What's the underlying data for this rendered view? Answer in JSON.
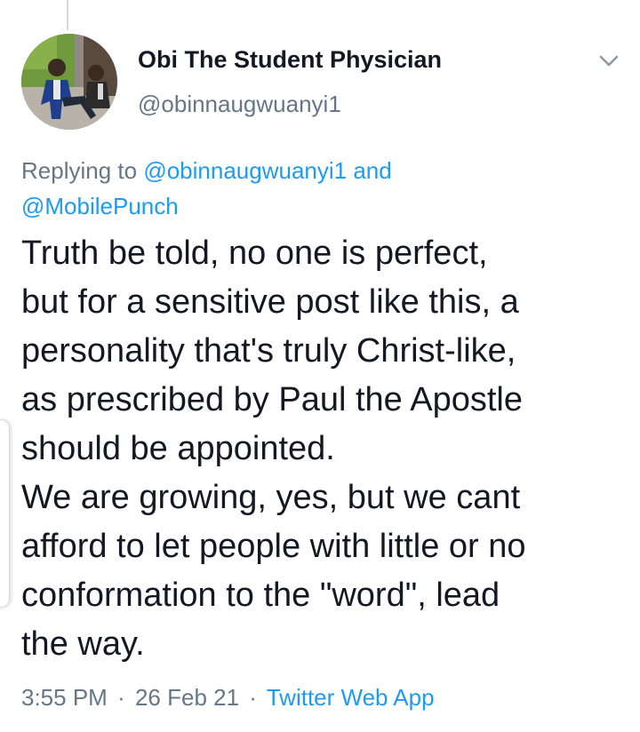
{
  "tweet": {
    "author": {
      "display_name": "Obi The Student Physician",
      "handle": "@obinnaugwuanyi1"
    },
    "reply_context": {
      "prefix": "Replying to",
      "mentions": [
        "@obinnaugwuanyi1",
        "@MobilePunch"
      ],
      "conjunction": "and"
    },
    "text_lines": [
      "Truth be told, no one is perfect,",
      "but for a sensitive post like this, a",
      "personality that's truly Christ-like,",
      "as prescribed by Paul the Apostle",
      "should be appointed.",
      "We are growing, yes, but we cant",
      "afford to let people with little or no",
      "conformation to the \"word\", lead",
      "the way."
    ],
    "time": "3:55 PM",
    "date": "26 Feb 21",
    "separator": "·",
    "source": "Twitter Web App"
  },
  "icons": {
    "menu": "chevron-down-icon",
    "avatar": "avatar"
  },
  "colors": {
    "text": "#141823",
    "muted": "#657786",
    "link": "#1d9bf0",
    "thread_line": "#cfd9de"
  }
}
